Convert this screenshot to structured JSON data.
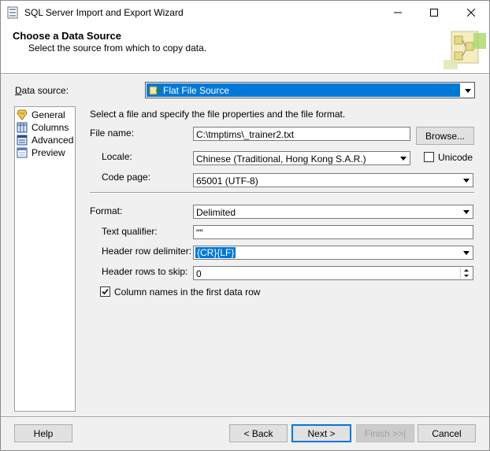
{
  "window": {
    "title": "SQL Server Import and Export Wizard"
  },
  "header": {
    "title": "Choose a Data Source",
    "subtitle": "Select the source from which to copy data."
  },
  "data_source": {
    "label": "Data source:",
    "value": "Flat File Source"
  },
  "nav": {
    "items": [
      {
        "label": "General",
        "icon": "general-icon"
      },
      {
        "label": "Columns",
        "icon": "columns-icon"
      },
      {
        "label": "Advanced",
        "icon": "advanced-icon"
      },
      {
        "label": "Preview",
        "icon": "preview-icon"
      }
    ]
  },
  "general": {
    "instruction": "Select a file and specify the file properties and the file format.",
    "file_name_label": "File name:",
    "file_name_value": "C:\\tmptims\\_trainer2.txt",
    "browse_label": "Browse...",
    "locale_label": "Locale:",
    "locale_value": "Chinese (Traditional, Hong Kong S.A.R.)",
    "unicode_label": "Unicode",
    "code_page_label": "Code page:",
    "code_page_value": "65001 (UTF-8)",
    "format_label": "Format:",
    "format_value": "Delimited",
    "text_qualifier_label": "Text qualifier:",
    "text_qualifier_value": "\"\"",
    "header_row_delimiter_label": "Header row delimiter:",
    "header_row_delimiter_value": "{CR}{LF}",
    "header_rows_to_skip_label": "Header rows to skip:",
    "header_rows_to_skip_value": "0",
    "column_names_label": "Column names in the first data row",
    "column_names_checked": true,
    "unicode_checked": false
  },
  "footer": {
    "help": "Help",
    "back": "< Back",
    "next": "Next >",
    "finish": "Finish >>|",
    "cancel": "Cancel"
  },
  "colors": {
    "selection": "#0078d7",
    "background": "#f0f0f0"
  }
}
